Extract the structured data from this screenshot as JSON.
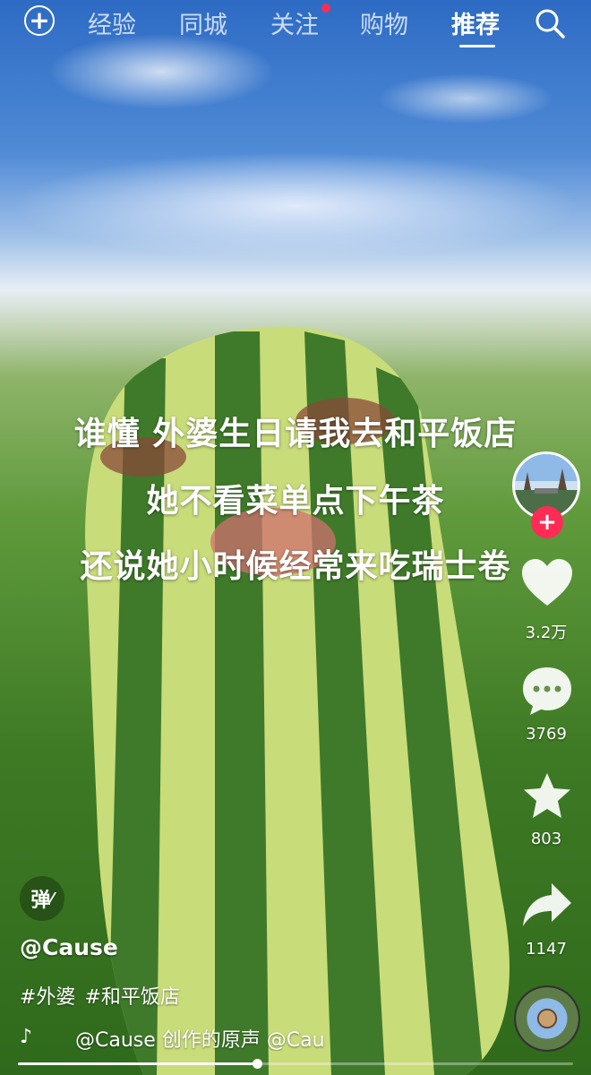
{
  "top_nav": {
    "tabs": [
      {
        "label": "经验"
      },
      {
        "label": "同城"
      },
      {
        "label": "关注"
      },
      {
        "label": "购物"
      },
      {
        "label": "推荐"
      }
    ],
    "active_tab": "推荐",
    "icons": {
      "left": "plus-circle-icon",
      "right": "search-icon"
    }
  },
  "video": {
    "caption_lines": [
      "谁懂 外婆生日请我去和平饭店",
      "她不看菜单点下午茶",
      "还说她小时候经常来吃瑞士卷"
    ],
    "progress": 0.43
  },
  "side_actions": {
    "like_count": "3.2万",
    "comment_count": "3769",
    "favorite_count": "803",
    "share_count": "1147"
  },
  "danmu_label": "弹",
  "author": "@Cause",
  "tags": [
    "#外婆",
    "#和平饭店"
  ],
  "music": {
    "text": "@Cause 创作的原声    @Cau"
  },
  "colors": {
    "accent": "#fe2c55",
    "text": "#ffffff"
  }
}
